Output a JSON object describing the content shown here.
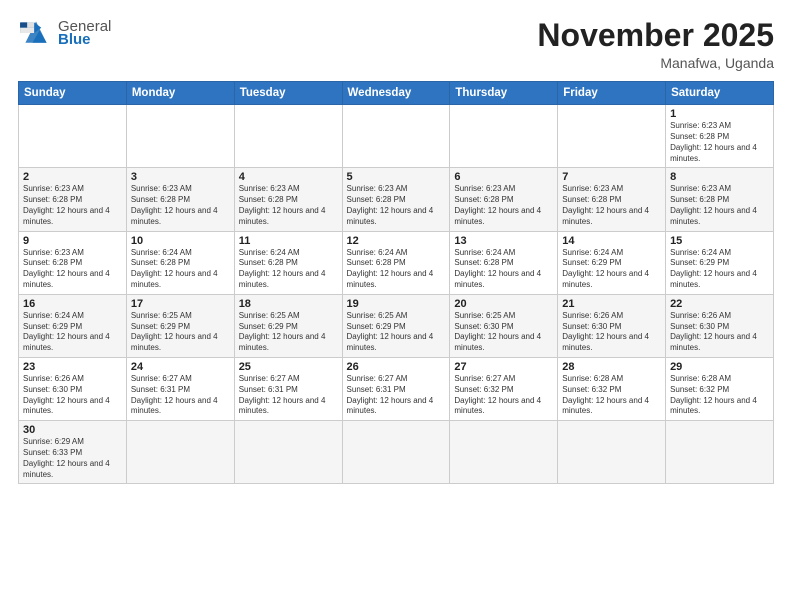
{
  "header": {
    "logo_general": "General",
    "logo_blue": "Blue",
    "month_title": "November 2025",
    "location": "Manafwa, Uganda"
  },
  "days_of_week": [
    "Sunday",
    "Monday",
    "Tuesday",
    "Wednesday",
    "Thursday",
    "Friday",
    "Saturday"
  ],
  "weeks": [
    [
      {
        "day": "",
        "info": ""
      },
      {
        "day": "",
        "info": ""
      },
      {
        "day": "",
        "info": ""
      },
      {
        "day": "",
        "info": ""
      },
      {
        "day": "",
        "info": ""
      },
      {
        "day": "",
        "info": ""
      },
      {
        "day": "1",
        "info": "Sunrise: 6:23 AM\nSunset: 6:28 PM\nDaylight: 12 hours and 4 minutes."
      }
    ],
    [
      {
        "day": "2",
        "info": "Sunrise: 6:23 AM\nSunset: 6:28 PM\nDaylight: 12 hours and 4 minutes."
      },
      {
        "day": "3",
        "info": "Sunrise: 6:23 AM\nSunset: 6:28 PM\nDaylight: 12 hours and 4 minutes."
      },
      {
        "day": "4",
        "info": "Sunrise: 6:23 AM\nSunset: 6:28 PM\nDaylight: 12 hours and 4 minutes."
      },
      {
        "day": "5",
        "info": "Sunrise: 6:23 AM\nSunset: 6:28 PM\nDaylight: 12 hours and 4 minutes."
      },
      {
        "day": "6",
        "info": "Sunrise: 6:23 AM\nSunset: 6:28 PM\nDaylight: 12 hours and 4 minutes."
      },
      {
        "day": "7",
        "info": "Sunrise: 6:23 AM\nSunset: 6:28 PM\nDaylight: 12 hours and 4 minutes."
      },
      {
        "day": "8",
        "info": "Sunrise: 6:23 AM\nSunset: 6:28 PM\nDaylight: 12 hours and 4 minutes."
      }
    ],
    [
      {
        "day": "9",
        "info": "Sunrise: 6:23 AM\nSunset: 6:28 PM\nDaylight: 12 hours and 4 minutes."
      },
      {
        "day": "10",
        "info": "Sunrise: 6:24 AM\nSunset: 6:28 PM\nDaylight: 12 hours and 4 minutes."
      },
      {
        "day": "11",
        "info": "Sunrise: 6:24 AM\nSunset: 6:28 PM\nDaylight: 12 hours and 4 minutes."
      },
      {
        "day": "12",
        "info": "Sunrise: 6:24 AM\nSunset: 6:28 PM\nDaylight: 12 hours and 4 minutes."
      },
      {
        "day": "13",
        "info": "Sunrise: 6:24 AM\nSunset: 6:28 PM\nDaylight: 12 hours and 4 minutes."
      },
      {
        "day": "14",
        "info": "Sunrise: 6:24 AM\nSunset: 6:29 PM\nDaylight: 12 hours and 4 minutes."
      },
      {
        "day": "15",
        "info": "Sunrise: 6:24 AM\nSunset: 6:29 PM\nDaylight: 12 hours and 4 minutes."
      }
    ],
    [
      {
        "day": "16",
        "info": "Sunrise: 6:24 AM\nSunset: 6:29 PM\nDaylight: 12 hours and 4 minutes."
      },
      {
        "day": "17",
        "info": "Sunrise: 6:25 AM\nSunset: 6:29 PM\nDaylight: 12 hours and 4 minutes."
      },
      {
        "day": "18",
        "info": "Sunrise: 6:25 AM\nSunset: 6:29 PM\nDaylight: 12 hours and 4 minutes."
      },
      {
        "day": "19",
        "info": "Sunrise: 6:25 AM\nSunset: 6:29 PM\nDaylight: 12 hours and 4 minutes."
      },
      {
        "day": "20",
        "info": "Sunrise: 6:25 AM\nSunset: 6:30 PM\nDaylight: 12 hours and 4 minutes."
      },
      {
        "day": "21",
        "info": "Sunrise: 6:26 AM\nSunset: 6:30 PM\nDaylight: 12 hours and 4 minutes."
      },
      {
        "day": "22",
        "info": "Sunrise: 6:26 AM\nSunset: 6:30 PM\nDaylight: 12 hours and 4 minutes."
      }
    ],
    [
      {
        "day": "23",
        "info": "Sunrise: 6:26 AM\nSunset: 6:30 PM\nDaylight: 12 hours and 4 minutes."
      },
      {
        "day": "24",
        "info": "Sunrise: 6:27 AM\nSunset: 6:31 PM\nDaylight: 12 hours and 4 minutes."
      },
      {
        "day": "25",
        "info": "Sunrise: 6:27 AM\nSunset: 6:31 PM\nDaylight: 12 hours and 4 minutes."
      },
      {
        "day": "26",
        "info": "Sunrise: 6:27 AM\nSunset: 6:31 PM\nDaylight: 12 hours and 4 minutes."
      },
      {
        "day": "27",
        "info": "Sunrise: 6:27 AM\nSunset: 6:32 PM\nDaylight: 12 hours and 4 minutes."
      },
      {
        "day": "28",
        "info": "Sunrise: 6:28 AM\nSunset: 6:32 PM\nDaylight: 12 hours and 4 minutes."
      },
      {
        "day": "29",
        "info": "Sunrise: 6:28 AM\nSunset: 6:32 PM\nDaylight: 12 hours and 4 minutes."
      }
    ],
    [
      {
        "day": "30",
        "info": "Sunrise: 6:29 AM\nSunset: 6:33 PM\nDaylight: 12 hours and 4 minutes."
      },
      {
        "day": "",
        "info": ""
      },
      {
        "day": "",
        "info": ""
      },
      {
        "day": "",
        "info": ""
      },
      {
        "day": "",
        "info": ""
      },
      {
        "day": "",
        "info": ""
      },
      {
        "day": "",
        "info": ""
      }
    ]
  ]
}
